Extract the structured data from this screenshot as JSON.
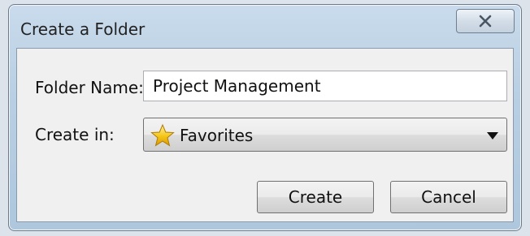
{
  "window": {
    "title": "Create a Folder",
    "close_icon": "close-icon"
  },
  "form": {
    "folder_name_label": "Folder Name:",
    "folder_name_value": "Project Management",
    "create_in_label": "Create in:",
    "create_in_value": "Favorites",
    "create_in_icon": "star-icon"
  },
  "buttons": {
    "create_label": "Create",
    "cancel_label": "Cancel"
  },
  "colors": {
    "titlebar": "#b9cfe3",
    "client_background": "#f0f0f0",
    "star": "#f5c518"
  }
}
